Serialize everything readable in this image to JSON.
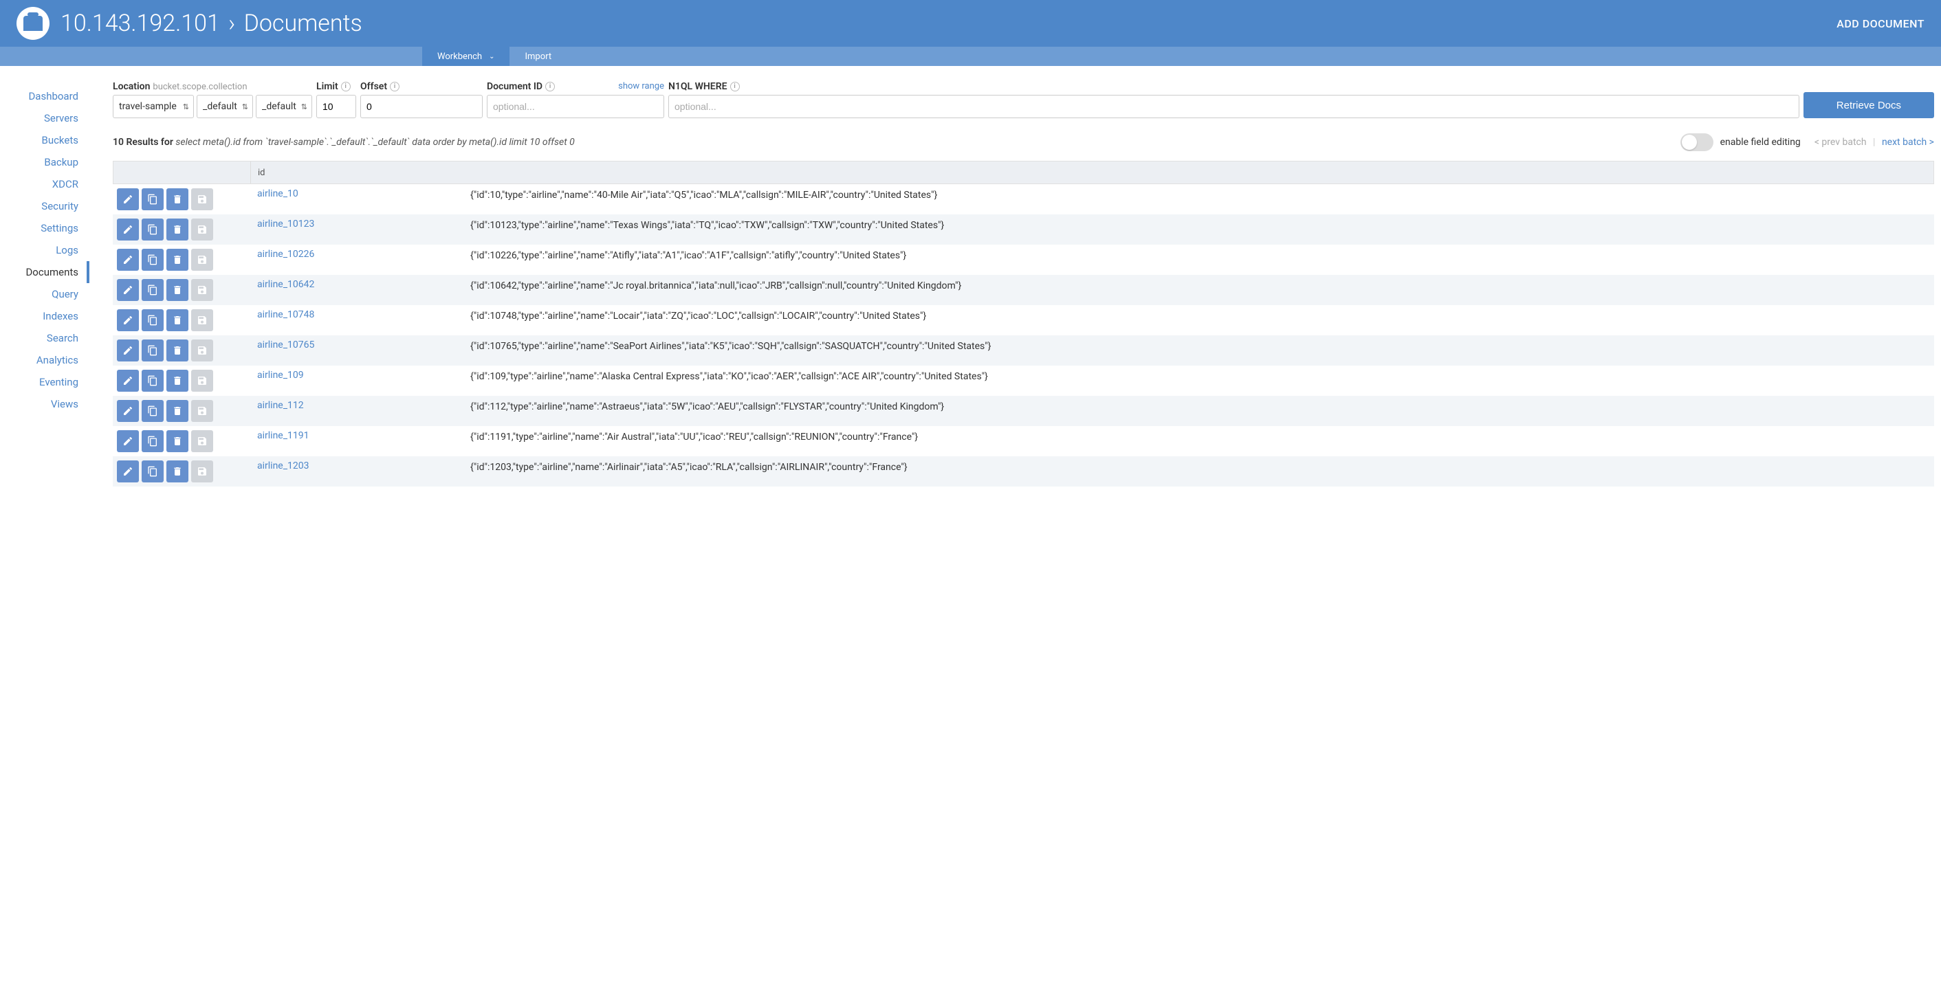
{
  "header": {
    "host": "10.143.192.101",
    "section": "Documents",
    "add_document": "ADD DOCUMENT"
  },
  "subtabs": {
    "workbench": "Workbench",
    "import": "Import"
  },
  "sidebar": {
    "items": [
      {
        "label": "Dashboard"
      },
      {
        "label": "Servers"
      },
      {
        "label": "Buckets"
      },
      {
        "label": "Backup"
      },
      {
        "label": "XDCR"
      },
      {
        "label": "Security"
      },
      {
        "label": "Settings"
      },
      {
        "label": "Logs"
      },
      {
        "label": "Documents",
        "active": true
      },
      {
        "label": "Query"
      },
      {
        "label": "Indexes"
      },
      {
        "label": "Search"
      },
      {
        "label": "Analytics"
      },
      {
        "label": "Eventing"
      },
      {
        "label": "Views"
      }
    ]
  },
  "controls": {
    "location_label": "Location",
    "location_hint": "bucket.scope.collection",
    "bucket": "travel-sample",
    "scope": "_default",
    "collection": "_default",
    "limit_label": "Limit",
    "limit_value": "10",
    "offset_label": "Offset",
    "offset_value": "0",
    "docid_label": "Document ID",
    "docid_placeholder": "optional...",
    "show_range": "show range",
    "where_label": "N1QL WHERE",
    "where_placeholder": "optional...",
    "retrieve": "Retrieve Docs"
  },
  "results": {
    "count_label": "10 Results for",
    "query": "select meta().id from `travel-sample`.`_default`.`_default` data order by meta().id limit 10 offset 0",
    "enable_editing": "enable field editing",
    "prev": "< prev batch",
    "next": "next batch >"
  },
  "table": {
    "header_id": "id",
    "rows": [
      {
        "id": "airline_10",
        "content": "{\"id\":10,\"type\":\"airline\",\"name\":\"40-Mile Air\",\"iata\":\"Q5\",\"icao\":\"MLA\",\"callsign\":\"MILE-AIR\",\"country\":\"United States\"}"
      },
      {
        "id": "airline_10123",
        "content": "{\"id\":10123,\"type\":\"airline\",\"name\":\"Texas Wings\",\"iata\":\"TQ\",\"icao\":\"TXW\",\"callsign\":\"TXW\",\"country\":\"United States\"}"
      },
      {
        "id": "airline_10226",
        "content": "{\"id\":10226,\"type\":\"airline\",\"name\":\"Atifly\",\"iata\":\"A1\",\"icao\":\"A1F\",\"callsign\":\"atifly\",\"country\":\"United States\"}"
      },
      {
        "id": "airline_10642",
        "content": "{\"id\":10642,\"type\":\"airline\",\"name\":\"Jc royal.britannica\",\"iata\":null,\"icao\":\"JRB\",\"callsign\":null,\"country\":\"United Kingdom\"}"
      },
      {
        "id": "airline_10748",
        "content": "{\"id\":10748,\"type\":\"airline\",\"name\":\"Locair\",\"iata\":\"ZQ\",\"icao\":\"LOC\",\"callsign\":\"LOCAIR\",\"country\":\"United States\"}"
      },
      {
        "id": "airline_10765",
        "content": "{\"id\":10765,\"type\":\"airline\",\"name\":\"SeaPort Airlines\",\"iata\":\"K5\",\"icao\":\"SQH\",\"callsign\":\"SASQUATCH\",\"country\":\"United States\"}"
      },
      {
        "id": "airline_109",
        "content": "{\"id\":109,\"type\":\"airline\",\"name\":\"Alaska Central Express\",\"iata\":\"KO\",\"icao\":\"AER\",\"callsign\":\"ACE AIR\",\"country\":\"United States\"}"
      },
      {
        "id": "airline_112",
        "content": "{\"id\":112,\"type\":\"airline\",\"name\":\"Astraeus\",\"iata\":\"5W\",\"icao\":\"AEU\",\"callsign\":\"FLYSTAR\",\"country\":\"United Kingdom\"}"
      },
      {
        "id": "airline_1191",
        "content": "{\"id\":1191,\"type\":\"airline\",\"name\":\"Air Austral\",\"iata\":\"UU\",\"icao\":\"REU\",\"callsign\":\"REUNION\",\"country\":\"France\"}"
      },
      {
        "id": "airline_1203",
        "content": "{\"id\":1203,\"type\":\"airline\",\"name\":\"Airlinair\",\"iata\":\"A5\",\"icao\":\"RLA\",\"callsign\":\"AIRLINAIR\",\"country\":\"France\"}"
      }
    ]
  }
}
